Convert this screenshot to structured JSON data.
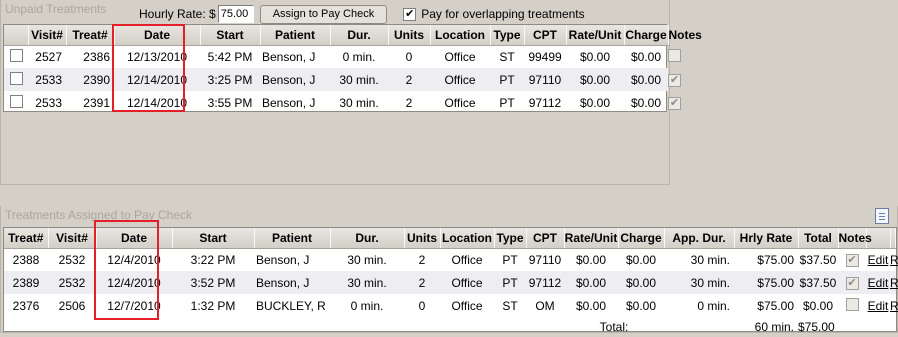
{
  "unpaid": {
    "title": "Unpaid Treatments",
    "hourly_rate_label": "Hourly Rate: $",
    "hourly_rate_value": "75.00",
    "assign_button": "Assign to Pay Check",
    "overlap_label": "Pay for overlapping treatments",
    "overlap_checked": true,
    "columns": [
      "",
      "Visit#",
      "Treat#",
      "Date",
      "Start",
      "Patient",
      "Dur.",
      "Units",
      "Location",
      "Type",
      "CPT",
      "Rate/Unit",
      "Charge",
      "Notes"
    ],
    "rows": [
      {
        "visit": "2527",
        "treat": "2386",
        "date": "12/13/2010",
        "start": "5:42 PM",
        "patient": "Benson, J",
        "dur": "0 min.",
        "units": "0",
        "location": "Office",
        "type": "ST",
        "cpt": "99499",
        "rate": "$0.00",
        "charge": "$0.00",
        "notes": false
      },
      {
        "visit": "2533",
        "treat": "2390",
        "date": "12/14/2010",
        "start": "3:25 PM",
        "patient": "Benson, J",
        "dur": "30 min.",
        "units": "2",
        "location": "Office",
        "type": "PT",
        "cpt": "97110",
        "rate": "$0.00",
        "charge": "$0.00",
        "notes": true
      },
      {
        "visit": "2533",
        "treat": "2391",
        "date": "12/14/2010",
        "start": "3:55 PM",
        "patient": "Benson, J",
        "dur": "30 min.",
        "units": "2",
        "location": "Office",
        "type": "PT",
        "cpt": "97112",
        "rate": "$0.00",
        "charge": "$0.00",
        "notes": true
      }
    ]
  },
  "assigned": {
    "title": "Treatments Assigned to Pay Check",
    "columns": [
      "Treat#",
      "Visit#",
      "Date",
      "Start",
      "Patient",
      "Dur.",
      "Units",
      "Location",
      "Type",
      "CPT",
      "Rate/Unit",
      "Charge",
      "App. Dur.",
      "Hrly Rate",
      "Total",
      "Notes",
      "",
      ""
    ],
    "rows": [
      {
        "treat": "2388",
        "visit": "2532",
        "date": "12/4/2010",
        "start": "3:22 PM",
        "patient": "Benson, J",
        "dur": "30 min.",
        "units": "2",
        "location": "Office",
        "type": "PT",
        "cpt": "97110",
        "rate": "$0.00",
        "charge": "$0.00",
        "app_dur": "30 min.",
        "hrly": "$75.00",
        "total": "$37.50",
        "notes": true,
        "edit": "Edit",
        "remove": "Remove"
      },
      {
        "treat": "2389",
        "visit": "2532",
        "date": "12/4/2010",
        "start": "3:52 PM",
        "patient": "Benson, J",
        "dur": "30 min.",
        "units": "2",
        "location": "Office",
        "type": "PT",
        "cpt": "97112",
        "rate": "$0.00",
        "charge": "$0.00",
        "app_dur": "30 min.",
        "hrly": "$75.00",
        "total": "$37.50",
        "notes": true,
        "edit": "Edit",
        "remove": "Remove"
      },
      {
        "treat": "2376",
        "visit": "2506",
        "date": "12/7/2010",
        "start": "1:32 PM",
        "patient": "BUCKLEY, R",
        "dur": "0 min.",
        "units": "0",
        "location": "Office",
        "type": "ST",
        "cpt": "OM",
        "rate": "$0.00",
        "charge": "$0.00",
        "app_dur": "0 min.",
        "hrly": "$75.00",
        "total": "$0.00",
        "notes": false,
        "edit": "Edit",
        "remove": "Remove"
      }
    ],
    "total_label": "Total:",
    "total_app_dur": "60 min.",
    "total_amount": "$75.00"
  },
  "colors": {
    "highlight_box": "#e3202a",
    "alt_row": "#eeedf2",
    "panel_bg": "#d4d0c8"
  },
  "icons": {
    "assigned_header_icon": "document-icon"
  }
}
